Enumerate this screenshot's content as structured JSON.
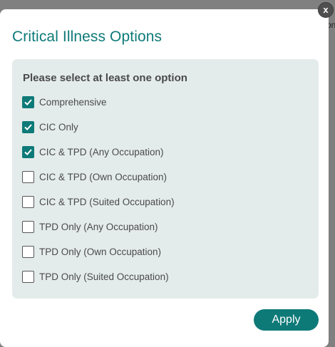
{
  "modal": {
    "title": "Critical Illness Options",
    "close_label": "x",
    "heading": "Please select at least one option",
    "options": [
      {
        "label": "Comprehensive",
        "checked": true
      },
      {
        "label": "CIC Only",
        "checked": true
      },
      {
        "label": "CIC & TPD (Any Occupation)",
        "checked": true
      },
      {
        "label": "CIC & TPD (Own Occupation)",
        "checked": false
      },
      {
        "label": "CIC & TPD (Suited Occupation)",
        "checked": false
      },
      {
        "label": "TPD Only (Any Occupation)",
        "checked": false
      },
      {
        "label": "TPD Only (Own Occupation)",
        "checked": false
      },
      {
        "label": "TPD Only (Suited Occupation)",
        "checked": false
      }
    ],
    "apply_label": "Apply"
  },
  "colors": {
    "accent": "#0e7a78",
    "panel": "#e4eceb"
  }
}
